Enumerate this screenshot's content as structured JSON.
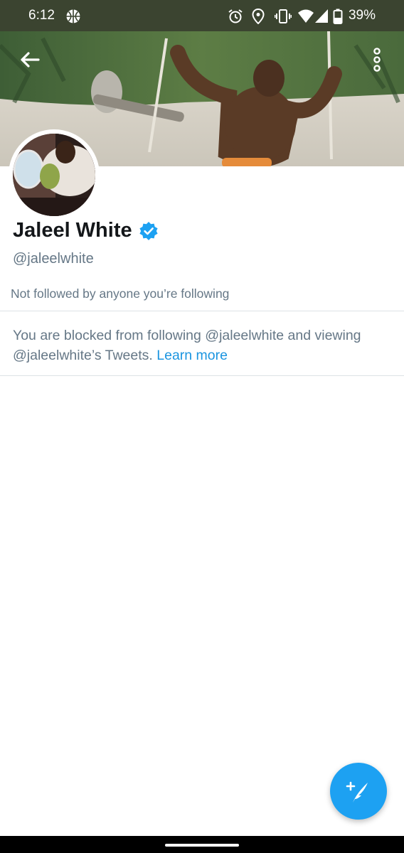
{
  "status_bar": {
    "time": "6:12",
    "battery_percent": "39%",
    "icons": [
      "basketball-icon",
      "alarm-icon",
      "location-icon",
      "vibrate-icon",
      "wifi-icon",
      "signal-icon",
      "battery-icon"
    ]
  },
  "header": {
    "back_icon": "arrow-left-icon",
    "more_icon": "more-vertical-icon"
  },
  "profile": {
    "display_name": "Jaleel White",
    "handle": "@jaleelwhite",
    "verified": true,
    "follow_context": "Not followed by anyone you’re following"
  },
  "blocked": {
    "message": "You are blocked from following @jaleelwhite and viewing @jaleelwhite’s Tweets. ",
    "link_label": "Learn more"
  },
  "fab": {
    "icon": "compose-tweet-icon"
  },
  "colors": {
    "accent": "#1da1f2",
    "link": "#1b95e0",
    "status_bar_bg": "#3b4430",
    "name_text": "#14171a",
    "secondary_text": "#657786",
    "divider": "#dde2e6"
  }
}
